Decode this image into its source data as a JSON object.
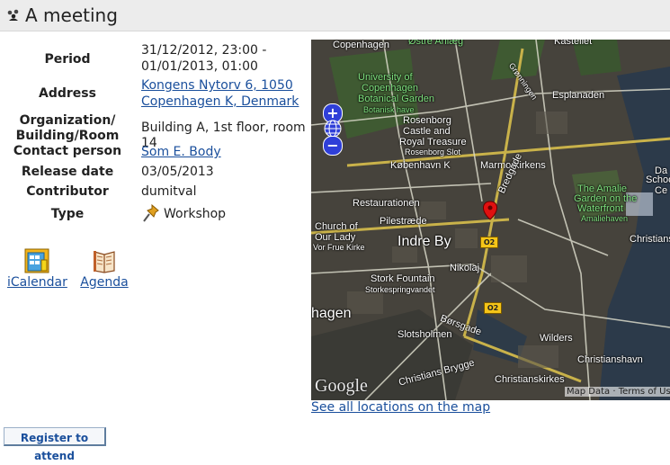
{
  "header": {
    "title": "A meeting",
    "icon": "people-group-icon"
  },
  "details": {
    "period_label": "Period",
    "period_value_line1": "31/12/2012, 23:00 -",
    "period_value_line2": "01/01/2013, 01:00",
    "address_label": "Address",
    "address_line1": "Kongens Nytorv 6, 1050",
    "address_line2": "Copenhagen K, Denmark",
    "org_label_line1": "Organization/",
    "org_label_line2": "Building/Room",
    "org_value": "Building A, 1st floor, room 14",
    "contact_label": "Contact person",
    "contact_value": "Som E. Body",
    "release_label": "Release date",
    "release_value": "03/05/2013",
    "contributor_label": "Contributor",
    "contributor_value": "dumitval",
    "type_label": "Type",
    "type_value": "Workshop",
    "type_icon": "pushpin-icon"
  },
  "actions": {
    "icalendar_label": "iCalendar",
    "agenda_label": "Agenda"
  },
  "map": {
    "labels": {
      "copenhagen": "Copenhagen",
      "ostre_anlaeg": "Østre Anlæg",
      "kastellet": "Kastellet",
      "botanical_1": "University of",
      "botanical_2": "Copenhagen",
      "botanical_3": "Botanical Garden",
      "botanical_4": "Botanisk have",
      "gronningen": "Grønningen",
      "esplanaden": "Esplanaden",
      "rosenborg_1": "Rosenborg",
      "rosenborg_2": "Castle and",
      "rosenborg_3": "Royal Treasure",
      "rosenborg_4": "Rosenborg Slot",
      "kobenhavn_k": "København K",
      "marmorkirken": "Marmorkirkens",
      "restaurationen": "Restaurationen",
      "amalie_1": "The Amalie",
      "amalie_2": "Garden on the",
      "amalie_3": "Waterfront",
      "amalie_4": "Amaliehaven",
      "dansk_1": "Da",
      "dansk_2": "Schoo",
      "dansk_3": "Ce",
      "church_1": "Church of",
      "church_2": "Our Lady",
      "church_3": "Vor Frue Kirke",
      "pilestraede": "Pilestræde",
      "bredgade": "Bredgade",
      "indre_by": "Indre By",
      "christians": "Christians",
      "nikolaj": "Nikolaj",
      "stork_1": "Stork Fountain",
      "stork_2": "Storkespringvandet",
      "hagen": "hagen",
      "borsgade": "Børsgade",
      "slotsholmen": "Slotsholmen",
      "wilders": "Wilders",
      "christianshavn": "Christianshavn",
      "christians_brygge": "Christians Brygge",
      "christianskirkes": "Christianskirkes",
      "o2a": "O2",
      "o2b": "O2",
      "google": "Google",
      "attribution": "Map Data · Terms of Use"
    },
    "marker": "red-map-marker"
  },
  "map_link": "See all locations on the map",
  "register_button": "Register to attend"
}
